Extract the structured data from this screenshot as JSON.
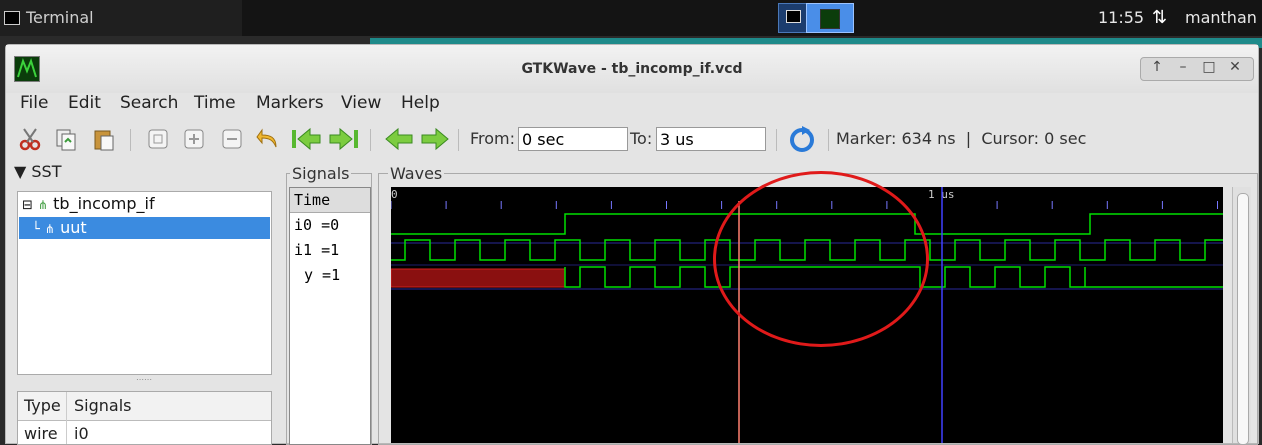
{
  "panel": {
    "task_label": "Terminal",
    "clock": "11:55",
    "user": "manthan"
  },
  "window": {
    "title": "GTKWave - tb_incomp_if.vcd"
  },
  "menu": [
    "File",
    "Edit",
    "Search",
    "Time",
    "Markers",
    "View",
    "Help"
  ],
  "toolbar": {
    "from_label": "From:",
    "from_value": "0 sec",
    "to_label": "To:",
    "to_value": "3 us",
    "status": "Marker: 634 ns  |  Cursor: 0 sec"
  },
  "sst": {
    "header": "▼ SST",
    "tree": [
      "tb_incomp_if",
      "uut"
    ],
    "table_headers": [
      "Type",
      "Signals"
    ],
    "rows": [
      {
        "type": "wire",
        "name": "i0"
      }
    ]
  },
  "signals": {
    "title": "Signals",
    "items": [
      "Time",
      "i0 =0",
      "i1 =1",
      "y =1"
    ]
  },
  "waves": {
    "title": "Waves",
    "ruler_start": "0",
    "ruler_mark": "1 us",
    "marker_ns": 634,
    "colors": {
      "wave": "#00e000",
      "marker": "#ff8070",
      "cursor": "#4040ff",
      "undefined": "#b01818"
    }
  }
}
